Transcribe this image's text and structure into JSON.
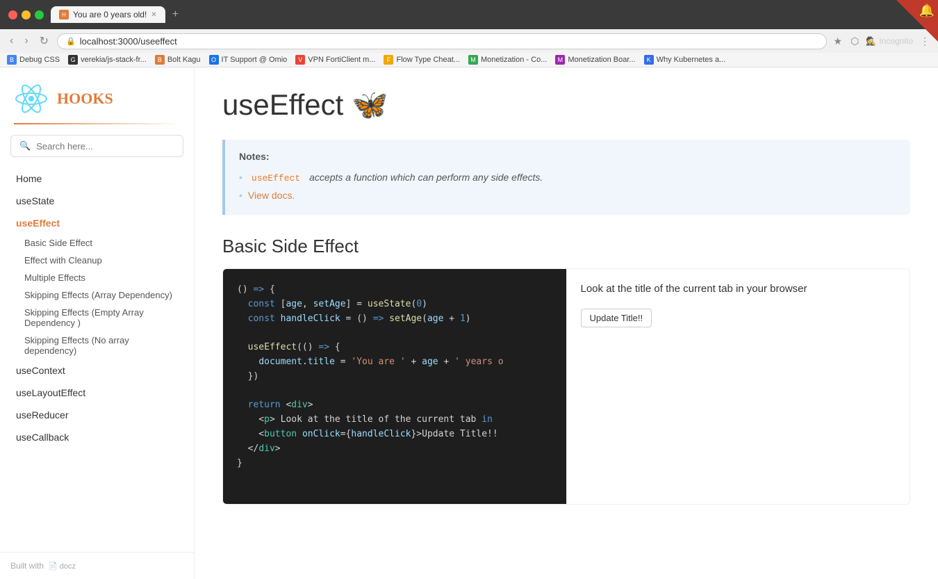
{
  "browser": {
    "tab_title": "You are 0 years old!",
    "url": "localhost:3000/useeffect",
    "new_tab_label": "+",
    "incognito_label": "Incognito",
    "bookmarks": [
      {
        "label": "Debug CSS",
        "icon": "B"
      },
      {
        "label": "verekia/js-stack-fr...",
        "icon": "G"
      },
      {
        "label": "Bolt Kagu",
        "icon": "B"
      },
      {
        "label": "IT Support @ Omio",
        "icon": "O"
      },
      {
        "label": "VPN FortiClient m...",
        "icon": "V"
      },
      {
        "label": "Flow Type Cheat...",
        "icon": "F"
      },
      {
        "label": "Monetization - Co...",
        "icon": "M"
      },
      {
        "label": "Monetization Boar...",
        "icon": "M"
      },
      {
        "label": "Why Kubernetes a...",
        "icon": "K"
      }
    ]
  },
  "sidebar": {
    "logo_text": "HOOKS",
    "search_placeholder": "Search here...",
    "nav_items": [
      {
        "label": "Home",
        "active": false
      },
      {
        "label": "useState",
        "active": false
      },
      {
        "label": "useEffect",
        "active": true
      }
    ],
    "sub_items": [
      {
        "label": "Basic Side Effect",
        "active": false
      },
      {
        "label": "Effect with Cleanup",
        "active": false
      },
      {
        "label": "Multiple Effects",
        "active": false
      },
      {
        "label": "Skipping Effects (Array Dependency)",
        "active": false
      },
      {
        "label": "Skipping Effects (Empty Array Dependency )",
        "active": false
      },
      {
        "label": "Skipping Effects (No array dependency)",
        "active": false
      }
    ],
    "more_items": [
      {
        "label": "useContext"
      },
      {
        "label": "useLayoutEffect"
      },
      {
        "label": "useReducer"
      },
      {
        "label": "useCallback"
      }
    ],
    "footer_text": "Built with"
  },
  "main": {
    "page_title": "useEffect 🦋",
    "notes_label": "Notes:",
    "note_code": "useEffect",
    "note_text": "accepts a function which can perform any side effects.",
    "view_docs_label": "View docs.",
    "section_title": "Basic Side Effect",
    "code_lines": [
      "() => {",
      "  const [age, setAge] = useState(0)",
      "  const handleClick = () => setAge(age + 1)",
      "",
      "  useEffect(() => {",
      "    document.title = 'You are ' + age + ' years o",
      "  })",
      "",
      "  return <div>",
      "    <p> Look at the title of the current tab in",
      "    <button onClick={handleClick}>Update Title!!",
      "  </div>",
      "}"
    ],
    "preview_text": "Look at the title of the current tab in your browser",
    "update_btn_label": "Update Title!!"
  }
}
